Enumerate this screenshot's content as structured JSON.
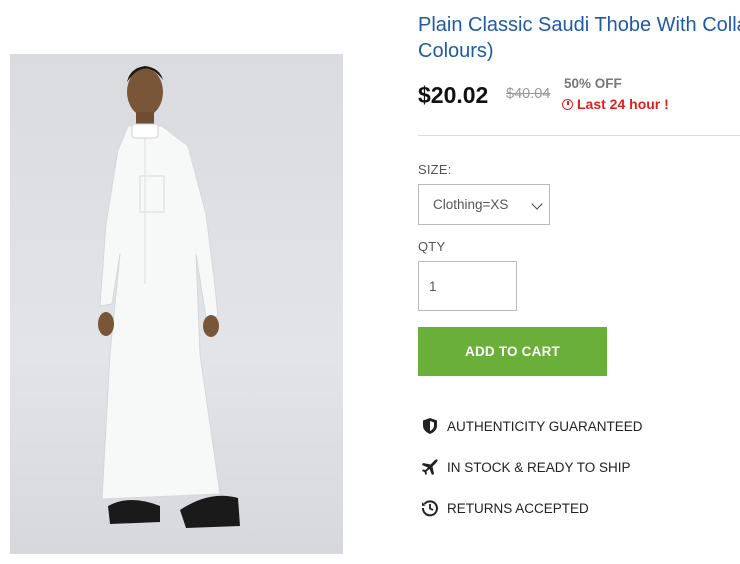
{
  "product": {
    "title": "Plain Classic Saudi Thobe With Colla Colours)",
    "price": "$20.02",
    "old_price": "$40.04",
    "discount": "50% OFF",
    "timer_text": "Last 24 hour !"
  },
  "options": {
    "size_label": "SIZE:",
    "size_value": "Clothing=XS",
    "qty_label": "QTY",
    "qty_value": "1"
  },
  "actions": {
    "add_to_cart": "ADD TO CART"
  },
  "features": [
    {
      "icon": "shield-icon",
      "label": "AUTHENTICITY GUARANTEED"
    },
    {
      "icon": "airplane-icon",
      "label": "IN STOCK & READY TO SHIP"
    },
    {
      "icon": "return-clock-icon",
      "label": "RETURNS ACCEPTED"
    }
  ],
  "colors": {
    "title": "#1f5aa6",
    "accent_red": "#e02020",
    "cart_green": "#6aaf3a"
  }
}
